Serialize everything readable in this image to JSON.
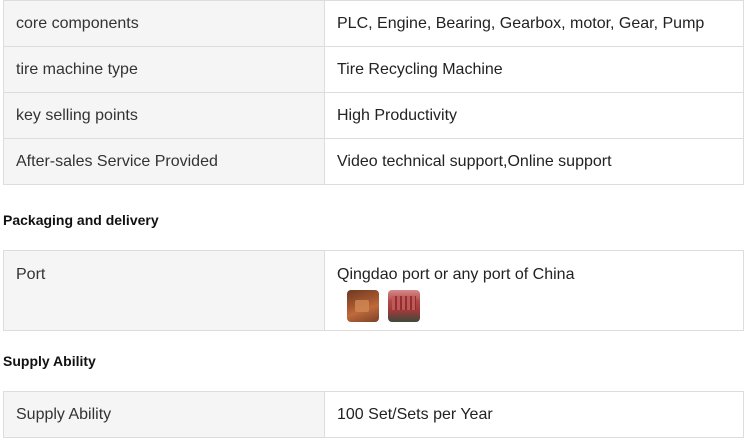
{
  "attributes_table": {
    "rows": [
      {
        "key": "core components",
        "value": "PLC, Engine, Bearing, Gearbox, motor, Gear, Pump"
      },
      {
        "key": "tire machine type",
        "value": "Tire Recycling Machine"
      },
      {
        "key": "key selling points",
        "value": "High Productivity"
      },
      {
        "key": "After-sales Service Provided",
        "value": "Video technical support,Online support"
      }
    ]
  },
  "packaging": {
    "title": "Packaging and delivery",
    "port_label": "Port",
    "port_value": "Qingdao port or any port of China"
  },
  "supply": {
    "title": "Supply Ability",
    "label": "Supply Ability",
    "value": "100 Set/Sets per Year"
  }
}
